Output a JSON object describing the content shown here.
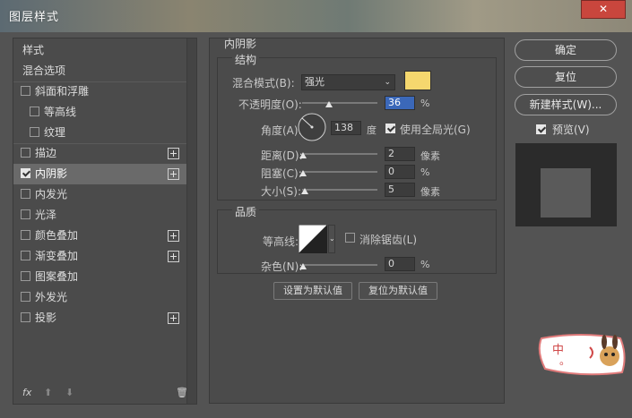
{
  "window": {
    "title": "图层样式",
    "close": "✕"
  },
  "sidebar": {
    "items": [
      {
        "label": "样式",
        "checkbox": false,
        "checked": false,
        "plus": false,
        "indent": 0,
        "selected": false
      },
      {
        "label": "混合选项",
        "checkbox": false,
        "checked": false,
        "plus": false,
        "indent": 0,
        "selected": false
      },
      {
        "label": "斜面和浮雕",
        "checkbox": true,
        "checked": false,
        "plus": false,
        "indent": 0,
        "selected": false
      },
      {
        "label": "等高线",
        "checkbox": true,
        "checked": false,
        "plus": false,
        "indent": 1,
        "selected": false
      },
      {
        "label": "纹理",
        "checkbox": true,
        "checked": false,
        "plus": false,
        "indent": 1,
        "selected": false
      },
      {
        "label": "描边",
        "checkbox": true,
        "checked": false,
        "plus": true,
        "indent": 0,
        "selected": false
      },
      {
        "label": "内阴影",
        "checkbox": true,
        "checked": true,
        "plus": true,
        "indent": 0,
        "selected": true
      },
      {
        "label": "内发光",
        "checkbox": true,
        "checked": false,
        "plus": false,
        "indent": 0,
        "selected": false
      },
      {
        "label": "光泽",
        "checkbox": true,
        "checked": false,
        "plus": false,
        "indent": 0,
        "selected": false
      },
      {
        "label": "颜色叠加",
        "checkbox": true,
        "checked": false,
        "plus": true,
        "indent": 0,
        "selected": false
      },
      {
        "label": "渐变叠加",
        "checkbox": true,
        "checked": false,
        "plus": true,
        "indent": 0,
        "selected": false
      },
      {
        "label": "图案叠加",
        "checkbox": true,
        "checked": false,
        "plus": false,
        "indent": 0,
        "selected": false
      },
      {
        "label": "外发光",
        "checkbox": true,
        "checked": false,
        "plus": false,
        "indent": 0,
        "selected": false
      },
      {
        "label": "投影",
        "checkbox": true,
        "checked": false,
        "plus": true,
        "indent": 0,
        "selected": false
      }
    ],
    "footer": {
      "fx": "fx",
      "up": "⬆",
      "down": "⬇",
      "trash": "🗑"
    }
  },
  "inner_shadow": {
    "section_title": "内阴影",
    "structure_title": "结构",
    "blend_mode_label": "混合模式(B):",
    "blend_mode_value": "强光",
    "color": "#f5d76e",
    "opacity_label": "不透明度(O):",
    "opacity_value": "36",
    "opacity_unit": "%",
    "opacity_fraction": 0.36,
    "angle_label": "角度(A):",
    "angle_value": "138",
    "angle_unit": "度",
    "global_light_label": "使用全局光(G)",
    "global_light_checked": true,
    "distance_label": "距离(D):",
    "distance_value": "2",
    "distance_unit": "像素",
    "choke_label": "阻塞(C):",
    "choke_value": "0",
    "choke_unit": "%",
    "size_label": "大小(S):",
    "size_value": "5",
    "size_unit": "像素",
    "quality_title": "品质",
    "contour_label": "等高线:",
    "antialias_label": "消除锯齿(L)",
    "antialias_checked": false,
    "noise_label": "杂色(N):",
    "noise_value": "0",
    "noise_unit": "%",
    "set_default_label": "设置为默认值",
    "reset_default_label": "复位为默认值"
  },
  "actions": {
    "ok_label": "确定",
    "reset_label": "复位",
    "new_style_label": "新建样式(W)...",
    "preview_label": "预览(V)",
    "preview_checked": true
  },
  "sticker": {
    "text": "中",
    "dots": "。"
  }
}
